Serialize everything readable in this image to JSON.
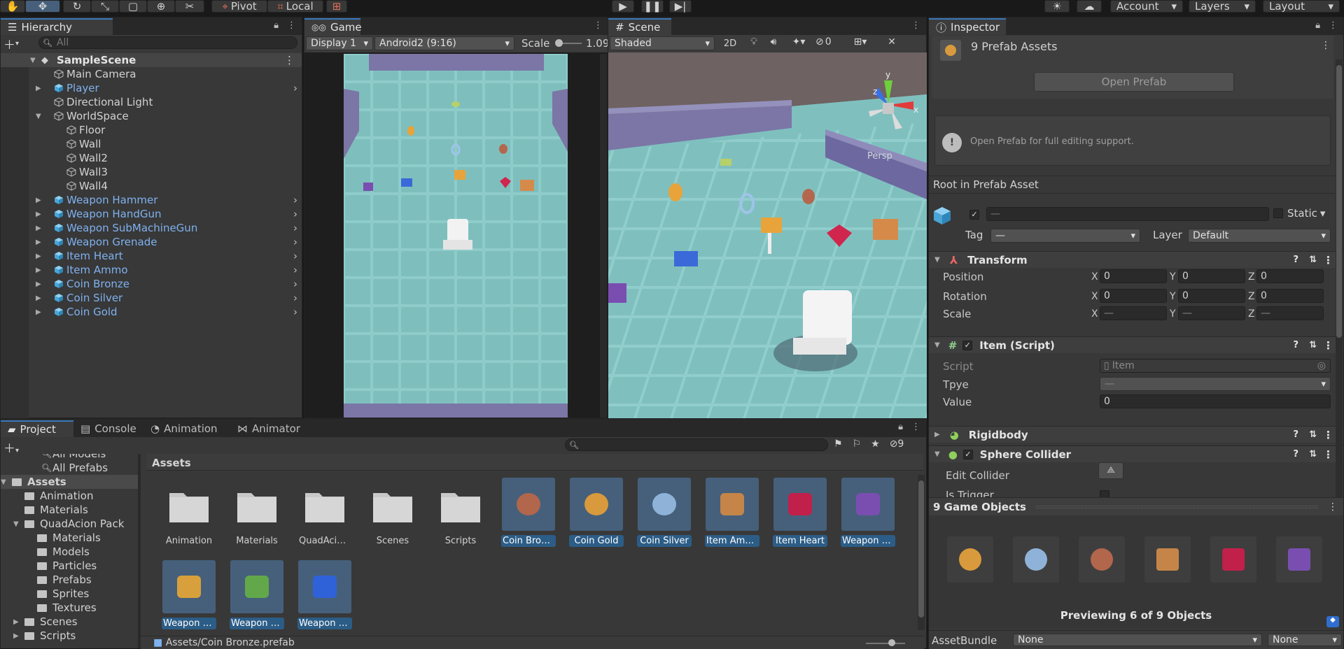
{
  "toolbar": {
    "pivot": "Pivot",
    "local": "Local",
    "account": "Account",
    "layers": "Layers",
    "layout": "Layout"
  },
  "hierarchy": {
    "title": "Hierarchy",
    "search_placeholder": "All",
    "scene": "SampleScene",
    "items": [
      {
        "label": "Main Camera",
        "indent": 1,
        "prefab": false,
        "expand": ""
      },
      {
        "label": "Player",
        "indent": 1,
        "prefab": true,
        "expand": "▶"
      },
      {
        "label": "Directional Light",
        "indent": 1,
        "prefab": false,
        "expand": ""
      },
      {
        "label": "WorldSpace",
        "indent": 1,
        "prefab": false,
        "expand": "▼"
      },
      {
        "label": "Floor",
        "indent": 2,
        "prefab": false,
        "expand": ""
      },
      {
        "label": "Wall",
        "indent": 2,
        "prefab": false,
        "expand": ""
      },
      {
        "label": "Wall2",
        "indent": 2,
        "prefab": false,
        "expand": ""
      },
      {
        "label": "Wall3",
        "indent": 2,
        "prefab": false,
        "expand": ""
      },
      {
        "label": "Wall4",
        "indent": 2,
        "prefab": false,
        "expand": ""
      },
      {
        "label": "Weapon Hammer",
        "indent": 1,
        "prefab": true,
        "expand": "▶"
      },
      {
        "label": "Weapon HandGun",
        "indent": 1,
        "prefab": true,
        "expand": "▶"
      },
      {
        "label": "Weapon SubMachineGun",
        "indent": 1,
        "prefab": true,
        "expand": "▶"
      },
      {
        "label": "Weapon Grenade",
        "indent": 1,
        "prefab": true,
        "expand": "▶"
      },
      {
        "label": "Item Heart",
        "indent": 1,
        "prefab": true,
        "expand": "▶"
      },
      {
        "label": "Item Ammo",
        "indent": 1,
        "prefab": true,
        "expand": "▶"
      },
      {
        "label": "Coin Bronze",
        "indent": 1,
        "prefab": true,
        "expand": "▶"
      },
      {
        "label": "Coin Silver",
        "indent": 1,
        "prefab": true,
        "expand": "▶"
      },
      {
        "label": "Coin Gold",
        "indent": 1,
        "prefab": true,
        "expand": "▶"
      }
    ]
  },
  "game": {
    "tab": "Game",
    "display": "Display 1",
    "resolution": "Android2 (9:16)",
    "scale_label": "Scale",
    "scale_value": "1.09"
  },
  "scene": {
    "tab": "Scene",
    "shading": "Shaded",
    "mode_2d": "2D",
    "hidden_count": "0",
    "persp": "Persp",
    "gizmo_y": "y",
    "gizmo_x": "x",
    "gizmo_z": "z"
  },
  "inspector": {
    "tab": "Inspector",
    "header": "9 Prefab Assets",
    "open_prefab": "Open Prefab",
    "info": "Open Prefab for full editing support.",
    "root_label": "Root in Prefab Asset",
    "name_value": "—",
    "static": "Static",
    "tag_label": "Tag",
    "tag_value": "—",
    "layer_label": "Layer",
    "layer_value": "Default",
    "transform": {
      "title": "Transform",
      "position": "Position",
      "rotation": "Rotation",
      "scale": "Scale",
      "pos": [
        "0",
        "0",
        "0"
      ],
      "rot": [
        "0",
        "0",
        "0"
      ],
      "scl": [
        "—",
        "—",
        "—"
      ],
      "axes": [
        "X",
        "Y",
        "Z"
      ]
    },
    "item_script": {
      "title": "Item (Script)",
      "script_label": "Script",
      "script_value": "Item",
      "type_label": "Tpye",
      "type_value": "—",
      "value_label": "Value",
      "value_value": "0"
    },
    "rigidbody": "Rigidbody",
    "sphere": {
      "title": "Sphere Collider",
      "edit": "Edit Collider",
      "trigger": "Is Trigger"
    },
    "preview_title": "9 Game Objects",
    "preview_caption": "Previewing 6 of 9 Objects",
    "assetbundle": {
      "label": "AssetBundle",
      "value1": "None",
      "value2": "None"
    }
  },
  "project": {
    "tabs": [
      "Project",
      "Console",
      "Animation",
      "Animator"
    ],
    "hidden_count": "9",
    "tree": [
      {
        "label": "All Models",
        "indent": 2,
        "expand": ""
      },
      {
        "label": "All Prefabs",
        "indent": 2,
        "expand": ""
      },
      {
        "label": "Assets",
        "indent": 0,
        "expand": "▼"
      },
      {
        "label": "Animation",
        "indent": 1,
        "expand": ""
      },
      {
        "label": "Materials",
        "indent": 1,
        "expand": ""
      },
      {
        "label": "QuadAcion Pack",
        "indent": 1,
        "expand": "▼"
      },
      {
        "label": "Materials",
        "indent": 2,
        "expand": ""
      },
      {
        "label": "Models",
        "indent": 2,
        "expand": ""
      },
      {
        "label": "Particles",
        "indent": 2,
        "expand": ""
      },
      {
        "label": "Prefabs",
        "indent": 2,
        "expand": ""
      },
      {
        "label": "Sprites",
        "indent": 2,
        "expand": ""
      },
      {
        "label": "Textures",
        "indent": 2,
        "expand": ""
      },
      {
        "label": "Scenes",
        "indent": 1,
        "expand": "▶"
      },
      {
        "label": "Scripts",
        "indent": 1,
        "expand": "▶"
      }
    ],
    "breadcrumb": "Assets",
    "assets": [
      {
        "label": "Animation",
        "kind": "folder",
        "sel": false,
        "color": ""
      },
      {
        "label": "Materials",
        "kind": "folder",
        "sel": false,
        "color": ""
      },
      {
        "label": "QuadAcion...",
        "kind": "folder",
        "sel": false,
        "color": ""
      },
      {
        "label": "Scenes",
        "kind": "folder",
        "sel": false,
        "color": ""
      },
      {
        "label": "Scripts",
        "kind": "folder",
        "sel": false,
        "color": ""
      },
      {
        "label": "Coin Bronze",
        "kind": "prefab",
        "sel": true,
        "color": "#b2664c"
      },
      {
        "label": "Coin Gold",
        "kind": "prefab",
        "sel": true,
        "color": "#d89a3c"
      },
      {
        "label": "Coin Silver",
        "kind": "prefab",
        "sel": true,
        "color": "#8fb3d8"
      },
      {
        "label": "Item Ammo",
        "kind": "prefab",
        "sel": true,
        "color": "#c58548"
      },
      {
        "label": "Item Heart",
        "kind": "prefab",
        "sel": true,
        "color": "#c0204a"
      },
      {
        "label": "Weapon G...",
        "kind": "prefab",
        "sel": true,
        "color": "#7a4eb0"
      },
      {
        "label": "Weapon H...",
        "kind": "prefab",
        "sel": true,
        "color": "#d8a03c"
      },
      {
        "label": "Weapon H...",
        "kind": "prefab",
        "sel": true,
        "color": "#62a84a"
      },
      {
        "label": "Weapon S...",
        "kind": "prefab",
        "sel": true,
        "color": "#2f62d8"
      }
    ],
    "status_path": "Assets/Coin Bronze.prefab"
  },
  "colors": {
    "accent": "#3a79bb",
    "selection": "#2c5d87",
    "prefab_text": "#7fb1ef",
    "floor": "#7cbcbd",
    "wall": "#7e7aa8"
  }
}
